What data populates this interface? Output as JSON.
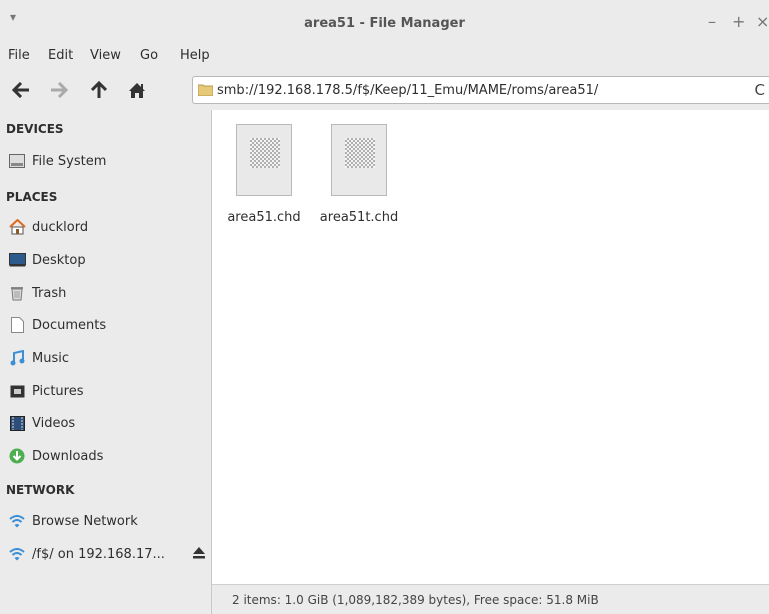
{
  "window": {
    "title": "area51 - File Manager",
    "menu_glyph": "▾",
    "controls": {
      "minimize": "–",
      "maximize": "+",
      "close": "×"
    }
  },
  "menubar": {
    "items": [
      "File",
      "Edit",
      "View",
      "Go",
      "Help"
    ]
  },
  "toolbar": {
    "back_icon": "back-arrow-icon",
    "forward_icon": "forward-arrow-icon",
    "up_icon": "up-arrow-icon",
    "home_icon": "home-icon",
    "address": "smb://192.168.178.5/f$/Keep/11_Emu/MAME/roms/area51/",
    "reload_glyph": "C"
  },
  "sidebar": {
    "sections": [
      {
        "title": "DEVICES",
        "items": [
          {
            "label": "File System",
            "icon": "drive-icon"
          }
        ]
      },
      {
        "title": "PLACES",
        "items": [
          {
            "label": "ducklord",
            "icon": "home-icon"
          },
          {
            "label": "Desktop",
            "icon": "desktop-icon"
          },
          {
            "label": "Trash",
            "icon": "trash-icon"
          },
          {
            "label": "Documents",
            "icon": "document-icon"
          },
          {
            "label": "Music",
            "icon": "music-icon"
          },
          {
            "label": "Pictures",
            "icon": "pictures-icon"
          },
          {
            "label": "Videos",
            "icon": "videos-icon"
          },
          {
            "label": "Downloads",
            "icon": "downloads-icon"
          }
        ]
      },
      {
        "title": "NETWORK",
        "items": [
          {
            "label": "Browse Network",
            "icon": "wifi-icon"
          },
          {
            "label": "/f$/ on 192.168.17...",
            "icon": "wifi-icon",
            "eject": "eject-icon"
          }
        ]
      }
    ]
  },
  "files": [
    {
      "name": "area51.chd",
      "icon": "file-icon"
    },
    {
      "name": "area51t.chd",
      "icon": "file-icon"
    }
  ],
  "status": {
    "text": "2 items: 1.0 GiB (1,089,182,389 bytes), Free space: 51.8 MiB"
  },
  "colors": {
    "accent": "#3b8fd6",
    "home": "#e06a1a",
    "download": "#4caf50"
  }
}
